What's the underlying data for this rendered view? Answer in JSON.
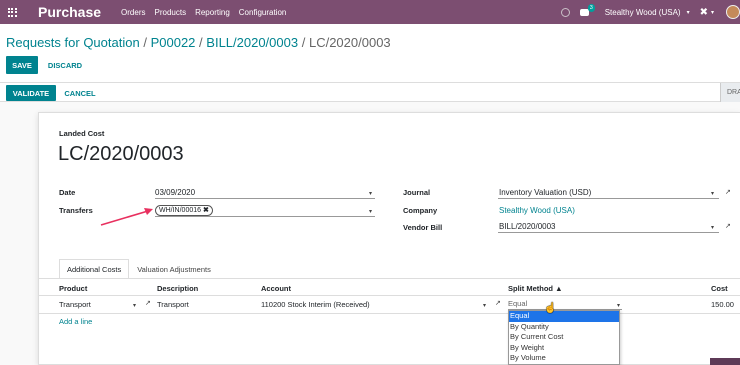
{
  "navbar": {
    "app_title": "Purchase",
    "menu": [
      "Orders",
      "Products",
      "Reporting",
      "Configuration"
    ],
    "chat_count": "3",
    "company": "Stealthy Wood (USA)",
    "caret": "▾",
    "debug_glyph": "✖",
    "colors": {
      "bar": "#7c4e71"
    }
  },
  "breadcrumb": {
    "items": [
      "Requests for Quotation",
      "P00022",
      "BILL/2020/0003"
    ],
    "separator": "/",
    "current": "LC/2020/0003"
  },
  "buttons": {
    "save": "Save",
    "discard": "Discard",
    "validate": "Validate",
    "cancel": "Cancel",
    "draft": "DRA"
  },
  "form": {
    "section_label": "Landed Cost",
    "name": "LC/2020/0003",
    "date_label": "Date",
    "date_value": "03/09/2020",
    "transfers_label": "Transfers",
    "transfer_tag": "WH/IN/00016",
    "tag_remove": "✖",
    "journal_label": "Journal",
    "journal_value": "Inventory Valuation (USD)",
    "company_label": "Company",
    "company_value": "Stealthy Wood (USA)",
    "vendor_bill_label": "Vendor Bill",
    "vendor_bill_value": "BILL/2020/0003",
    "caret": "▾",
    "external_link": "↗"
  },
  "tabs": [
    "Additional Costs",
    "Valuation Adjustments"
  ],
  "table": {
    "headers": {
      "product": "Product",
      "description": "Description",
      "account": "Account",
      "split_method": "Split Method ▲",
      "cost": "Cost"
    },
    "row": {
      "product": "Transport",
      "description": "Transport",
      "account": "110200 Stock Interim (Received)",
      "split_method": "Equal",
      "cost": "150.00"
    },
    "add_line": "Add a line"
  },
  "split_options": [
    "Equal",
    "By Quantity",
    "By Current Cost",
    "By Weight",
    "By Volume"
  ],
  "selected_split": "Equal",
  "accent_color": "#00838f"
}
